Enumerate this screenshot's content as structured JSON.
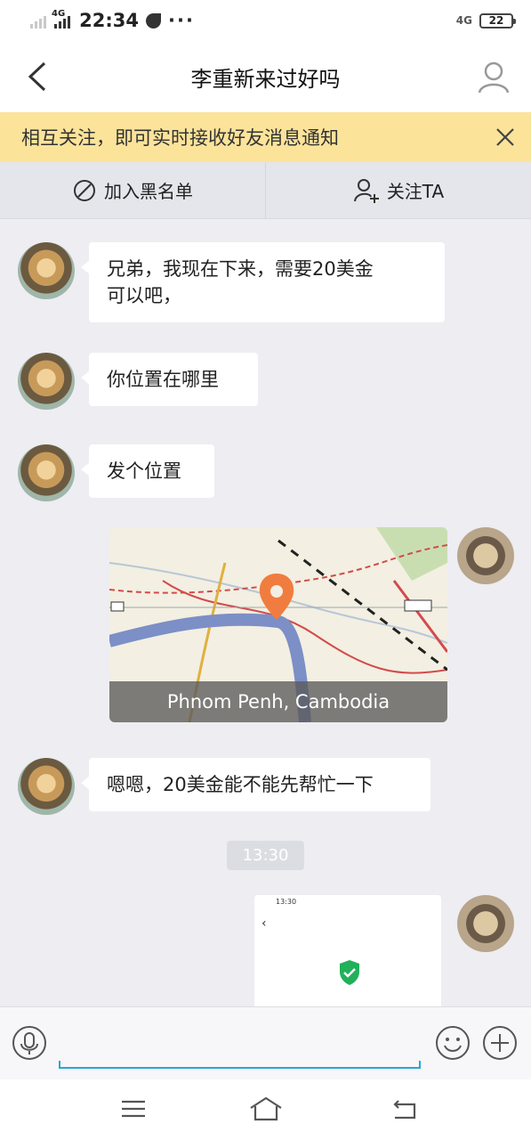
{
  "status_bar": {
    "network": "4G",
    "time": "22:34",
    "overflow": "···",
    "right_network": "4G",
    "battery": "22"
  },
  "header": {
    "title": "李重新来过好吗"
  },
  "notice": {
    "text": "相互关注，即可实时接收好友消息通知"
  },
  "actions": {
    "blacklist_label": "加入黑名单",
    "follow_label": "关注TA"
  },
  "messages": [
    {
      "side": "left",
      "text_line1": "兄弟，我现在下来，需要20美金",
      "text_line2": "可以吧，",
      "avatar": "girl-avatar"
    },
    {
      "side": "left",
      "text": "你位置在哪里",
      "avatar": "girl-avatar"
    },
    {
      "side": "left",
      "text": "发个位置",
      "avatar": "girl-avatar"
    },
    {
      "side": "right",
      "type": "location",
      "location": "Phnom Penh, Cambodia",
      "avatar": "up-avatar"
    },
    {
      "side": "left",
      "text": "嗯嗯，20美金能不能先帮忙一下",
      "avatar": "girl-avatar"
    },
    {
      "side": "right",
      "type": "image",
      "mini_time": "13:30",
      "avatar": "up-avatar"
    }
  ],
  "timestamp": "13:30",
  "icons": {
    "back": "back-chevron-icon",
    "profile": "profile-icon",
    "close": "close-icon",
    "block": "block-icon",
    "follow": "add-user-icon",
    "mic": "microphone-icon",
    "emoji": "emoji-icon",
    "plus": "plus-icon",
    "menu": "menu-icon",
    "home": "home-icon",
    "return": "return-icon",
    "map_pin": "map-pin-icon",
    "shield": "shield-icon"
  },
  "colors": {
    "notice_bg": "#fbe39a",
    "map_pin": "#f07d3f",
    "input_accent": "#28a6d9",
    "shield": "#22b05a"
  }
}
